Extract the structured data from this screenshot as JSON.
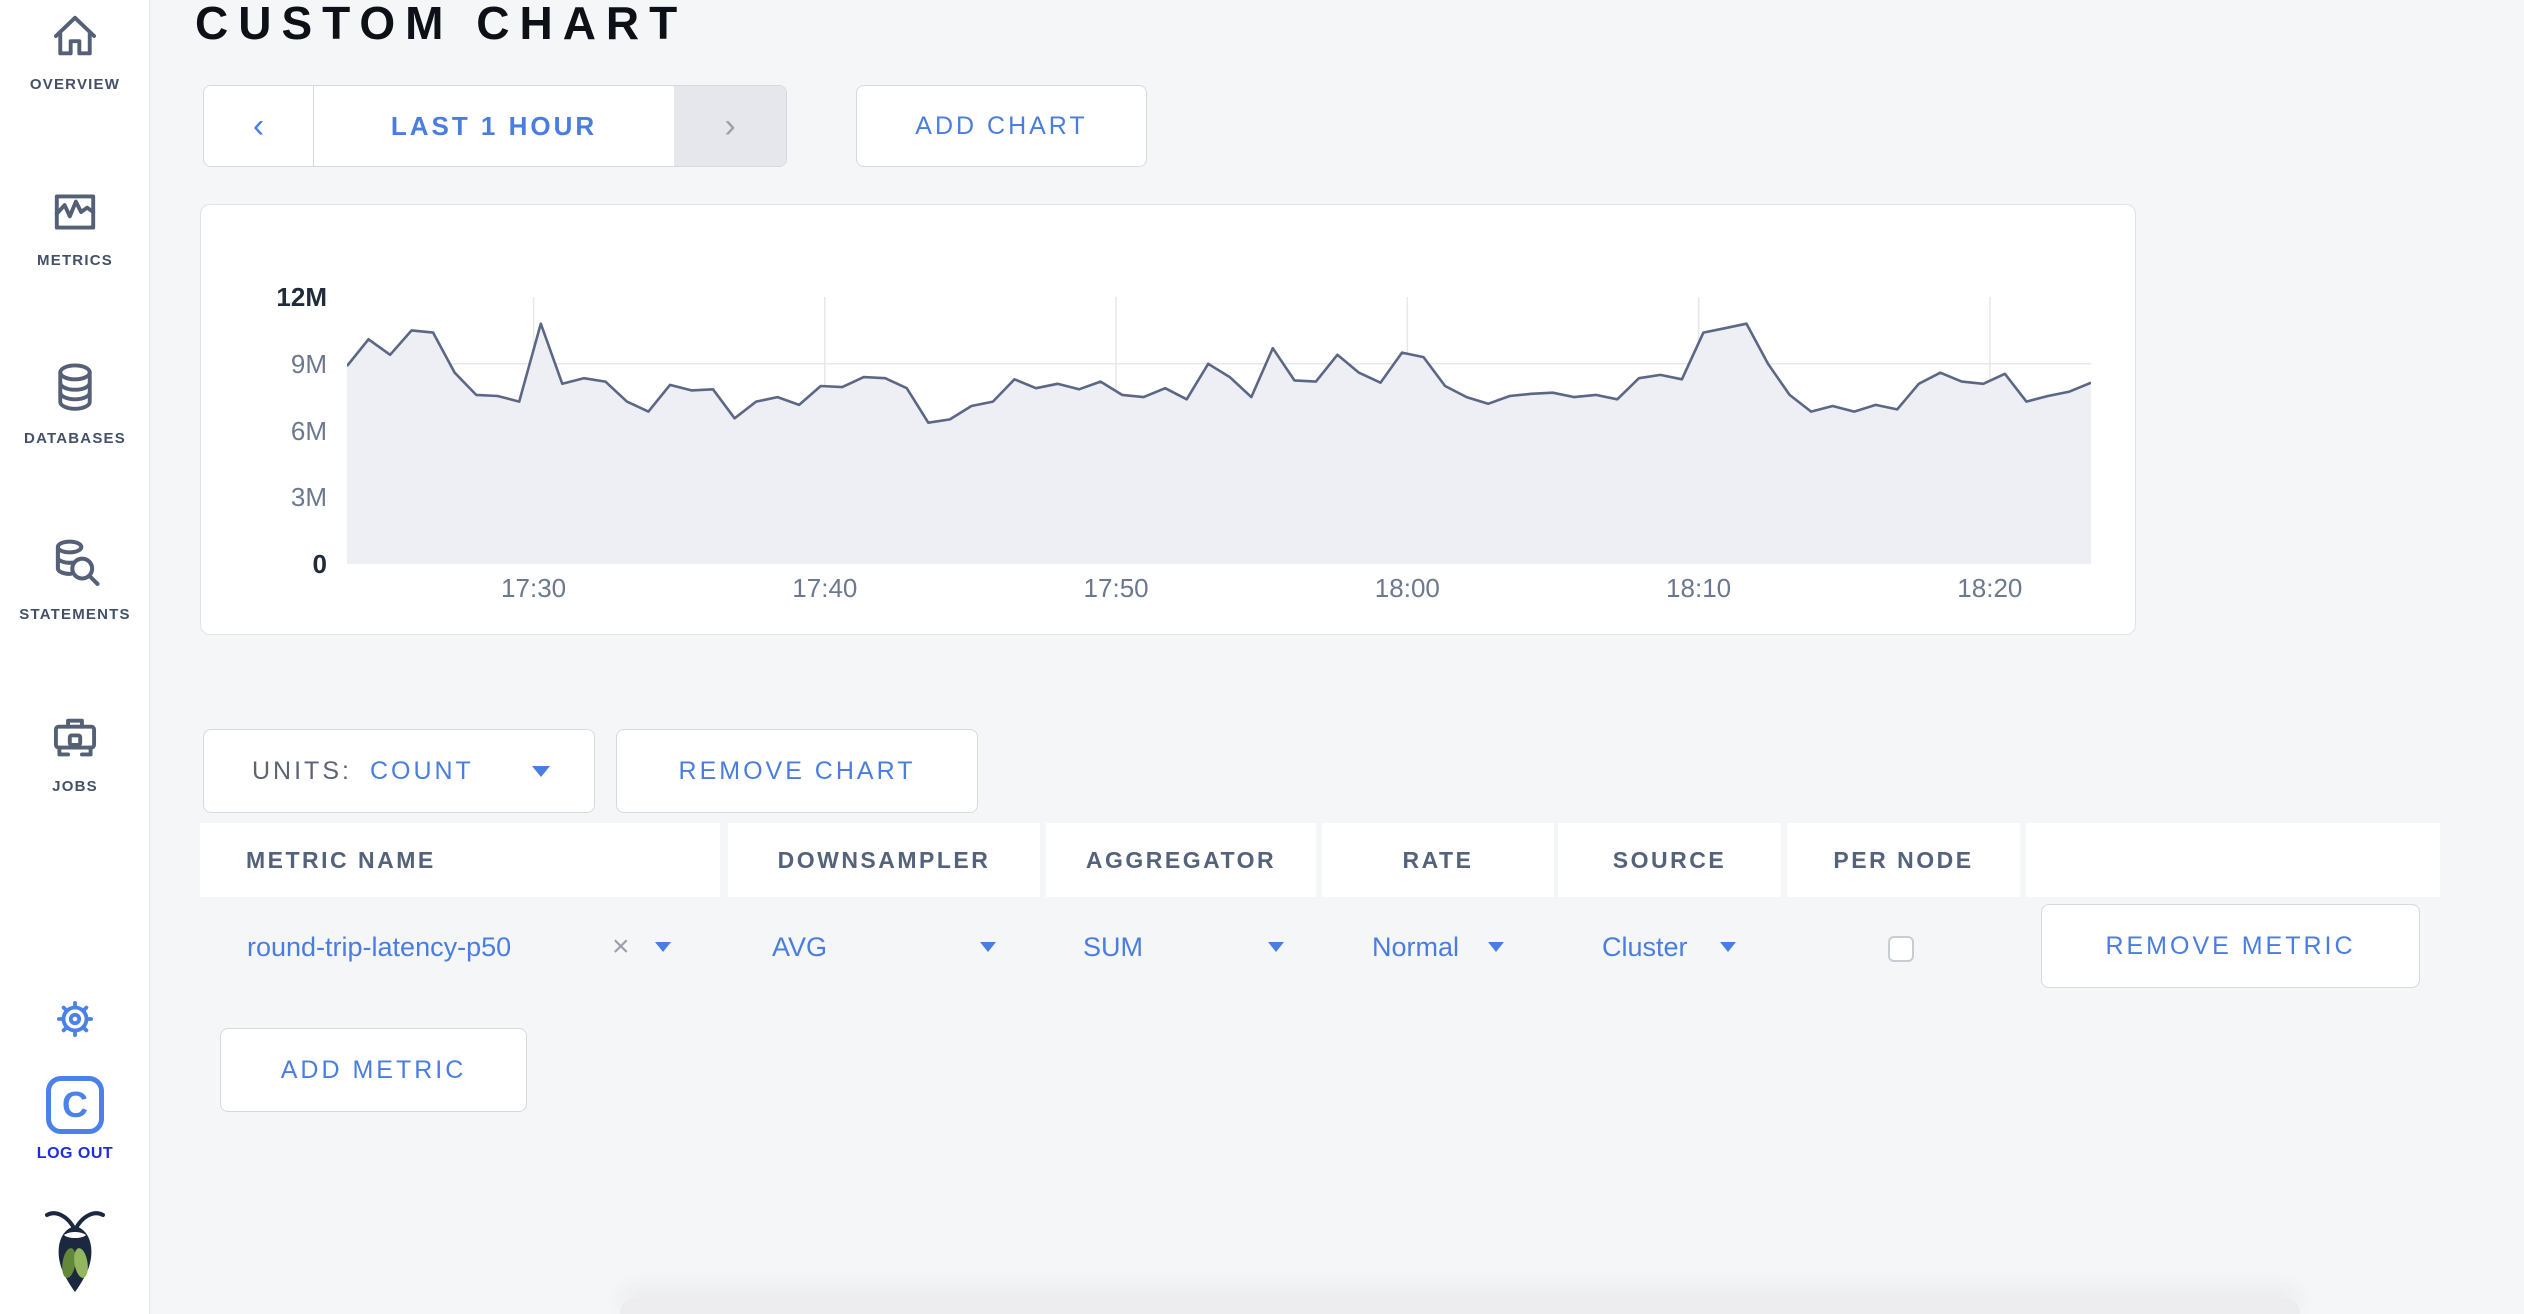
{
  "colors": {
    "accent_blue": "#4a7de2",
    "logout_blue": "#212be0",
    "gear_blue": "#4a82e9",
    "sidebar_icon_slate": "#556077",
    "title_black": "#0d1117",
    "chart_line": "#5b6784",
    "chart_fill": "#edeff4",
    "gridline": "#e7e8ec",
    "axis_gray": "#6b7890",
    "axis_dark": "#222b3a",
    "page_background": "#f5f6f7"
  },
  "sidebar": {
    "items": [
      {
        "label": "OVERVIEW",
        "icon": "home-icon"
      },
      {
        "label": "METRICS",
        "icon": "metrics-icon"
      },
      {
        "label": "DATABASES",
        "icon": "database-icon"
      },
      {
        "label": "STATEMENTS",
        "icon": "statements-icon"
      },
      {
        "label": "JOBS",
        "icon": "jobs-icon"
      }
    ],
    "logout_initial": "C",
    "logout_label": "LOG OUT"
  },
  "page": {
    "title": "CUSTOM CHART"
  },
  "toolbar": {
    "prev_arrow": "‹",
    "time_range": "LAST 1 HOUR",
    "next_arrow": "›",
    "add_chart": "ADD CHART"
  },
  "controls": {
    "units_label": "UNITS:",
    "units_value": "COUNT",
    "remove_chart": "REMOVE CHART",
    "remove_metric": "REMOVE METRIC",
    "add_metric": "ADD METRIC"
  },
  "table": {
    "headers": [
      "METRIC NAME",
      "DOWNSAMPLER",
      "AGGREGATOR",
      "RATE",
      "SOURCE",
      "PER NODE",
      ""
    ],
    "row": {
      "metric_name": "round-trip-latency-p50",
      "clear_glyph": "×",
      "downsampler": "AVG",
      "aggregator": "SUM",
      "rate": "Normal",
      "source": "Cluster",
      "per_node_checked": false
    }
  },
  "chart_data": {
    "type": "area",
    "title": "",
    "units": "count",
    "x_range": [
      "17:23",
      "18:23"
    ],
    "ylim_millions": [
      0,
      12
    ],
    "grid": true,
    "y_ticks": [
      {
        "label": "12M",
        "value_millions": 12,
        "emphasis": true
      },
      {
        "label": "9M",
        "value_millions": 9
      },
      {
        "label": "6M",
        "value_millions": 6
      },
      {
        "label": "3M",
        "value_millions": 3
      },
      {
        "label": "0",
        "value_millions": 0,
        "emphasis": true
      }
    ],
    "y_gridlines_millions": [
      3,
      6,
      9
    ],
    "x_ticks": [
      {
        "label": "17:30",
        "frac": 0.107
      },
      {
        "label": "17:40",
        "frac": 0.274
      },
      {
        "label": "17:50",
        "frac": 0.441
      },
      {
        "label": "18:00",
        "frac": 0.608
      },
      {
        "label": "18:10",
        "frac": 0.775
      },
      {
        "label": "18:20",
        "frac": 0.942
      }
    ],
    "series": [
      {
        "name": "round-trip-latency-p50",
        "values_millions": [
          8.9,
          10.1,
          9.4,
          10.5,
          10.4,
          8.6,
          7.6,
          7.55,
          7.3,
          10.8,
          8.1,
          8.35,
          8.2,
          7.3,
          6.85,
          8.05,
          7.8,
          7.85,
          6.55,
          7.3,
          7.5,
          7.15,
          8.0,
          7.95,
          8.4,
          8.35,
          7.9,
          6.35,
          6.5,
          7.1,
          7.3,
          8.3,
          7.9,
          8.1,
          7.85,
          8.2,
          7.6,
          7.5,
          7.9,
          7.4,
          9.0,
          8.4,
          7.5,
          9.7,
          8.25,
          8.2,
          9.4,
          8.6,
          8.15,
          9.5,
          9.3,
          8.0,
          7.5,
          7.2,
          7.55,
          7.65,
          7.7,
          7.5,
          7.6,
          7.4,
          8.35,
          8.5,
          8.3,
          10.4,
          10.6,
          10.8,
          9.0,
          7.6,
          6.85,
          7.1,
          6.85,
          7.15,
          6.95,
          8.1,
          8.6,
          8.2,
          8.1,
          8.55,
          7.3,
          7.55,
          7.75,
          8.15
        ]
      }
    ]
  }
}
